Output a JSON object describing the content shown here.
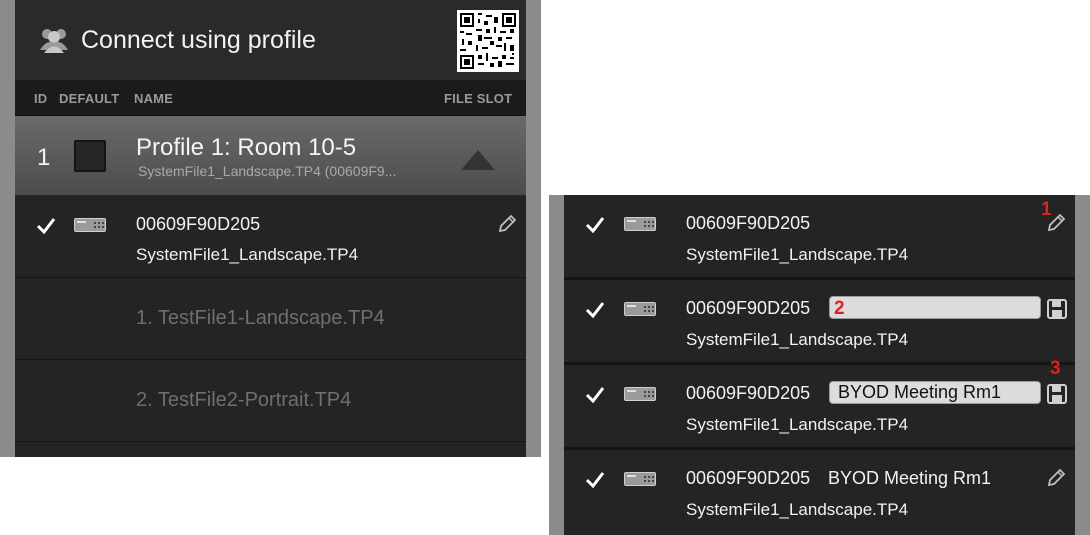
{
  "left": {
    "header": {
      "title": "Connect using profile"
    },
    "columns": {
      "id": "ID",
      "default": "DEFAULT",
      "name": "NAME",
      "file_slot": "FILE SLOT"
    },
    "profile": {
      "id": "1",
      "name": "Profile 1: Room 10-5",
      "subtitle": "SystemFile1_Landscape.TP4 (00609F9..."
    },
    "device": {
      "mac": "00609F90D205",
      "file": "SystemFile1_Landscape.TP4"
    },
    "files": [
      "1. TestFile1-Landscape.TP4",
      "2. TestFile2-Portrait.TP4"
    ]
  },
  "right": {
    "rows": [
      {
        "mac": "00609F90D205",
        "file": "SystemFile1_Landscape.TP4",
        "marker": "1"
      },
      {
        "mac": "00609F90D205",
        "file": "SystemFile1_Landscape.TP4",
        "marker": "2",
        "field_value": ""
      },
      {
        "mac": "00609F90D205",
        "file": "SystemFile1_Landscape.TP4",
        "marker": "3",
        "field_value": "BYOD Meeting Rm1"
      },
      {
        "mac": "00609F90D205",
        "name": "BYOD Meeting Rm1",
        "file": "SystemFile1_Landscape.TP4"
      }
    ]
  },
  "icons": {
    "users": "users-icon",
    "qr": "qr-code-icon",
    "check": "checkmark-icon",
    "device": "device-icon",
    "edit": "pencil-icon",
    "save": "save-icon",
    "collapse": "triangle-up-icon"
  },
  "colors": {
    "marker": "#e02020",
    "panel_bg": "#242424",
    "frame": "#8b8b8b"
  }
}
